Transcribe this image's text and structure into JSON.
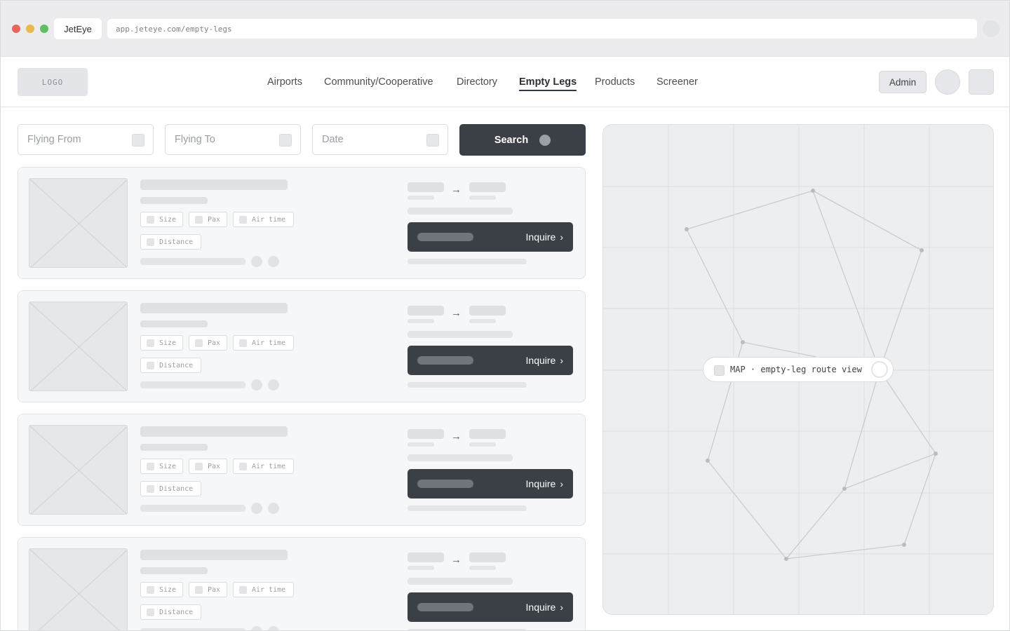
{
  "browser": {
    "tab_title": "JetEye",
    "url": "app.jeteye.com/empty-legs"
  },
  "header": {
    "logo": "LOGO",
    "nav": [
      {
        "label": "Airports",
        "active": false
      },
      {
        "label": "Community/Cooperative",
        "active": false
      },
      {
        "label": "Directory",
        "active": false
      },
      {
        "label": "Empty Legs",
        "active": true
      },
      {
        "label": "Products",
        "active": false
      },
      {
        "label": "Screener",
        "active": false
      }
    ],
    "admin_label": "Admin"
  },
  "search": {
    "from_placeholder": "Flying From",
    "to_placeholder": "Flying To",
    "date_placeholder": "Date",
    "button_label": "Search"
  },
  "cards": [
    {
      "chips": [
        "Size",
        "Pax",
        "Air time",
        "Distance"
      ],
      "route_arrow": "→",
      "inquire_label": "Inquire",
      "chevron": "›"
    },
    {
      "chips": [
        "Size",
        "Pax",
        "Air time",
        "Distance"
      ],
      "route_arrow": "→",
      "inquire_label": "Inquire",
      "chevron": "›"
    },
    {
      "chips": [
        "Size",
        "Pax",
        "Air time",
        "Distance"
      ],
      "route_arrow": "→",
      "inquire_label": "Inquire",
      "chevron": "›"
    },
    {
      "chips": [
        "Size",
        "Pax",
        "Air time",
        "Distance"
      ],
      "route_arrow": "→",
      "inquire_label": "Inquire",
      "chevron": "›"
    }
  ],
  "map": {
    "label": "MAP · empty-leg route view"
  },
  "colors": {
    "primary_dark": "#3b4047",
    "skeleton": "#dfe1e4",
    "map_bg": "#edeef0"
  },
  "icons": {
    "field_icon": "calendar-icon",
    "search_icon": "search-icon",
    "route_arrow": "arrow-right-icon",
    "inquire_chevron": "chevron-right-icon"
  }
}
